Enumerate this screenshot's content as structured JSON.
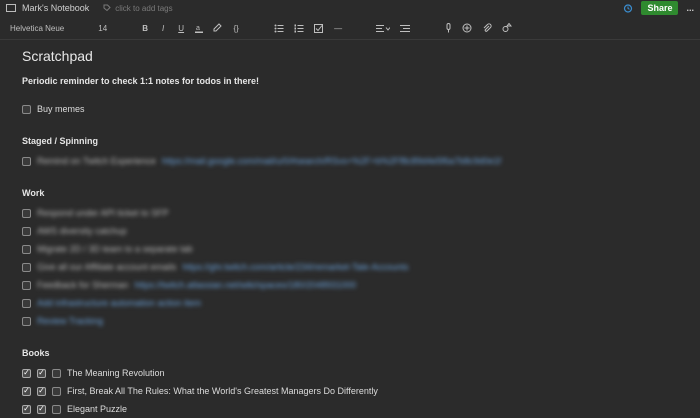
{
  "header": {
    "notebook": "Mark's Notebook",
    "tags_placeholder": "click to add tags",
    "share_label": "Share",
    "more_label": "..."
  },
  "toolbar": {
    "font": "Helvetica Neue",
    "size": "14",
    "bold": "B",
    "italic": "I",
    "underline": "U",
    "code": "{}",
    "hr": "—"
  },
  "note": {
    "title": "Scratchpad",
    "reminder": "Periodic reminder to check 1:1 notes for todos in there!",
    "buy": "Buy memes",
    "sections": {
      "staged": "Staged / Spinning",
      "work": "Work",
      "books": "Books"
    },
    "staged_items": [
      {
        "text": "Remind on Twitch Experience",
        "link": "https://mail.google.com/mail/u/0/#search/RSvs+%2F+b%2Ff8c89d4e5f6a7b8c9d0e1f"
      }
    ],
    "work_items": [
      {
        "text": "Respond under API ticket to SFP",
        "link": ""
      },
      {
        "text": "AWS diversity catchup",
        "link": ""
      },
      {
        "text": "Migrate 2D / 3D team to a separate tab",
        "link": ""
      },
      {
        "text": "Give all our Affiliate account emails",
        "link": "https://ghr.twitch.com/article/234/remarket-Tale-Accounts"
      },
      {
        "text": "Feedback for Sherman",
        "link": "https://twitch.atlassian.net/wiki/spaces/180/2048931000"
      },
      {
        "text": "Add infrastructure automation action item",
        "link": ""
      },
      {
        "text": "Review Tracking",
        "link": ""
      }
    ],
    "books": [
      {
        "title": "The Meaning Revolution"
      },
      {
        "title": "First, Break All The Rules: What the World's Greatest Managers Do Differently"
      },
      {
        "title": "Elegant Puzzle"
      }
    ]
  }
}
